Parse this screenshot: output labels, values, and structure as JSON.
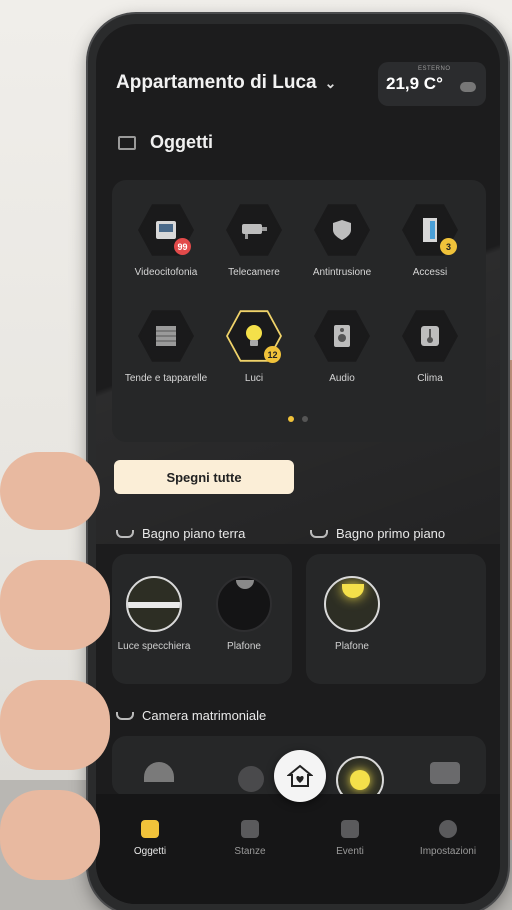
{
  "header": {
    "title": "Appartamento di Luca",
    "weather_label": "ESTERNO",
    "temperature": "21,9 C°"
  },
  "section": {
    "title": "Oggetti"
  },
  "categories": [
    {
      "label": "Videocitofonia",
      "badge": "99",
      "badge_color": "#e24a4a",
      "icon": "intercom-icon"
    },
    {
      "label": "Telecamere",
      "icon": "camera-icon"
    },
    {
      "label": "Antintrusione",
      "icon": "shield-icon"
    },
    {
      "label": "Accessi",
      "badge": "3",
      "badge_color": "#f0c23a",
      "icon": "door-icon"
    },
    {
      "label": "Tende e tapparelle",
      "icon": "shutter-icon"
    },
    {
      "label": "Luci",
      "badge": "12",
      "badge_color": "#f0c23a",
      "icon": "bulb-icon"
    },
    {
      "label": "Audio",
      "icon": "speaker-icon"
    },
    {
      "label": "Clima",
      "icon": "thermometer-icon"
    }
  ],
  "pager": {
    "pages": 2,
    "current": 1
  },
  "actions": {
    "all_off": "Spegni tutte"
  },
  "rooms": [
    {
      "name": "Bagno piano terra",
      "lights": [
        {
          "label": "Luce specchiera",
          "on": true
        },
        {
          "label": "Plafone",
          "on": false
        }
      ]
    },
    {
      "name": "Bagno primo piano",
      "lights": [
        {
          "label": "Plafone",
          "on": true
        }
      ]
    },
    {
      "name": "Camera matrimoniale",
      "lights": []
    }
  ],
  "nav": {
    "items": [
      {
        "label": "Oggetti",
        "active": true
      },
      {
        "label": "Stanze",
        "active": false
      },
      {
        "label": "Eventi",
        "active": false
      },
      {
        "label": "Impostazioni",
        "active": false
      }
    ]
  },
  "colors": {
    "accent": "#f0c23a",
    "button_bg": "#fbeed7",
    "screen_bg": "#1c1c1d",
    "card_bg": "#262728"
  }
}
